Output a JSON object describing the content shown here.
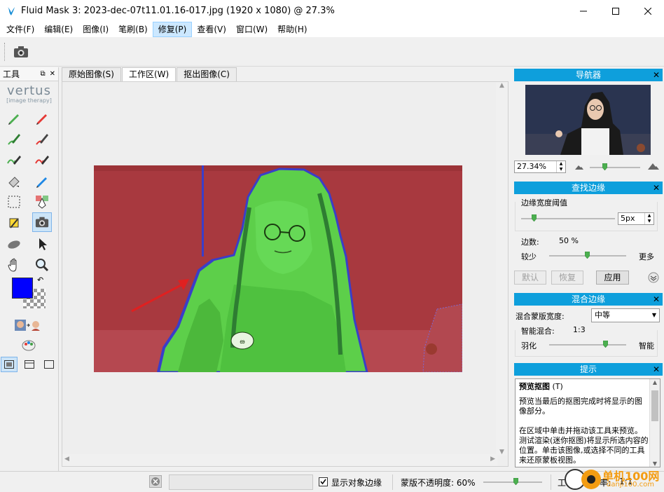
{
  "window": {
    "title": "Fluid Mask 3: 2023-dec-07t11.01.16-017.jpg (1920 x 1080) @ 27.3%",
    "minimize": "—",
    "maximize": "☐",
    "close": "✕"
  },
  "menu": [
    "文件(F)",
    "编辑(E)",
    "图像(I)",
    "笔刷(B)",
    "修复(P)",
    "查看(V)",
    "窗口(W)",
    "帮助(H)"
  ],
  "tools_panel": {
    "title": "工具",
    "logo_main": "vertus",
    "logo_sub": "[image therapy]"
  },
  "tabs": [
    "原始图像(S)",
    "工作区(W)",
    "抠出图像(C)"
  ],
  "navigator": {
    "title": "导航器",
    "zoom_value": "27.34%"
  },
  "find_edges": {
    "title": "查找边缘",
    "width_label": "边缘宽度阈值",
    "width_value": "5px",
    "count_label": "边数:",
    "count_value": "50 %",
    "less_label": "较少",
    "more_label": "更多",
    "default_btn": "默认",
    "restore_btn": "恢复",
    "apply_btn": "应用"
  },
  "blend_edges": {
    "title": "混合边缘",
    "mask_width_label": "混合蒙版宽度:",
    "mask_width_value": "中等",
    "smart_blend_label": "智能混合:",
    "smart_blend_value": "1:3",
    "feather_label": "羽化",
    "smart_label": "智能"
  },
  "hints": {
    "title": "提示",
    "heading": "预览抠图",
    "shortcut": "(T)",
    "para1": "预览当最后的抠图完成时将显示的图像部分。",
    "para2": "在区域中单击并拖动该工具来预览。测试渲染(迷你抠图)将显示所选内容的位置。单击该图像,或选择不同的工具来还原蒙板视图。"
  },
  "status": {
    "show_edges_label": "显示对象边缘",
    "show_edges_checked": true,
    "opacity_label": "蒙版不透明度: 60%",
    "work_label": "工作区",
    "ratio_label": "率:",
    "ratio_value": "1:1"
  },
  "watermark": {
    "text1": "单机100网",
    "text2": "danji100.com"
  },
  "colors": {
    "accent": "#0e9fdc",
    "foreground_color": "#0000ff",
    "keep_mask": "#5dcf4a",
    "drop_mask": "#a8393f",
    "arrow": "#e02020"
  }
}
